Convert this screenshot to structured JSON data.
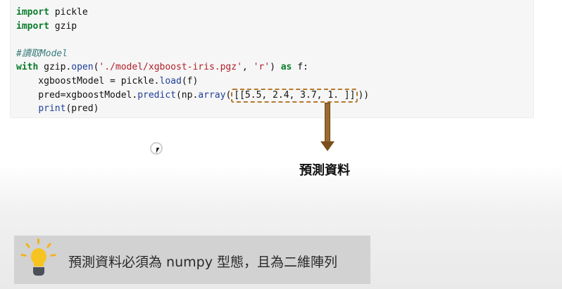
{
  "code_lines": [
    {
      "tokens": [
        {
          "t": "import",
          "c": "kw"
        },
        {
          "t": " pickle",
          "c": ""
        }
      ]
    },
    {
      "tokens": [
        {
          "t": "import",
          "c": "kw"
        },
        {
          "t": " gzip",
          "c": ""
        }
      ]
    },
    {
      "tokens": []
    },
    {
      "tokens": [
        {
          "t": "#讀取Model",
          "c": "cmt"
        }
      ]
    },
    {
      "tokens": [
        {
          "t": "with",
          "c": "kw"
        },
        {
          "t": " gzip.",
          "c": ""
        },
        {
          "t": "open",
          "c": "fn"
        },
        {
          "t": "(",
          "c": ""
        },
        {
          "t": "'./model/xgboost-iris.pgz'",
          "c": "str"
        },
        {
          "t": ", ",
          "c": ""
        },
        {
          "t": "'r'",
          "c": "str"
        },
        {
          "t": ") ",
          "c": ""
        },
        {
          "t": "as",
          "c": "kw"
        },
        {
          "t": " f:",
          "c": ""
        }
      ]
    },
    {
      "tokens": [
        {
          "t": "    xgboostModel = pickle.",
          "c": ""
        },
        {
          "t": "load",
          "c": "fn"
        },
        {
          "t": "(f)",
          "c": ""
        }
      ]
    },
    {
      "tokens": [
        {
          "t": "    pred=xgboostModel.",
          "c": ""
        },
        {
          "t": "predict",
          "c": "fn"
        },
        {
          "t": "(np.",
          "c": ""
        },
        {
          "t": "array",
          "c": "fn"
        },
        {
          "t": "(",
          "c": ""
        },
        {
          "t": "[[5.5, 2.4, 3.7, 1. ]]",
          "c": "hl"
        },
        {
          "t": "))",
          "c": ""
        }
      ]
    },
    {
      "tokens": [
        {
          "t": "    ",
          "c": ""
        },
        {
          "t": "print",
          "c": "fn"
        },
        {
          "t": "(pred)",
          "c": ""
        }
      ]
    }
  ],
  "annotation": "預測資料",
  "caption": "預測資料必須為 numpy 型態，且為二維陣列",
  "icons": {
    "arrow": "down-arrow-icon",
    "bulb": "lightbulb-icon",
    "cursor": "mouse-cursor-icon"
  },
  "colors": {
    "keyword": "#0a7d2c",
    "string": "#b0202a",
    "comment": "#3b7c7c",
    "highlight_border": "#b8782a",
    "arrow": "#9c6a2e",
    "bulb": "#f7c321"
  }
}
